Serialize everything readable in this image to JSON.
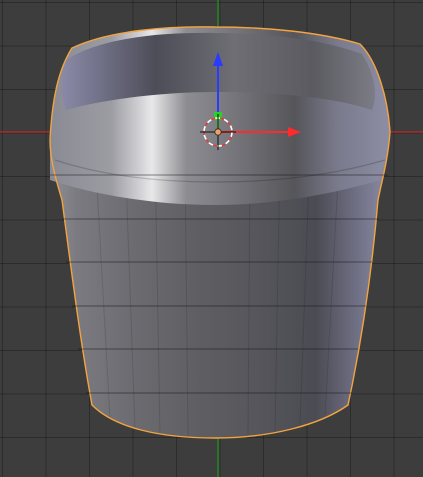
{
  "viewport": {
    "type": "3d-view",
    "grid_color": "#2a2a2a",
    "background_color": "#3d3d3d"
  },
  "axes": {
    "x_axis": {
      "label": "X",
      "color": "#d02626"
    },
    "y_axis": {
      "label": "Y",
      "color": "#18a418"
    }
  },
  "mesh": {
    "name": "cup-mesh",
    "selected": true,
    "outline_color": "#f2a441",
    "face_color_light": "#c8c8d2",
    "face_color_mid": "#6d6d72",
    "face_color_dark": "#4b4b52"
  },
  "manipulator": {
    "x_arrow_color": "#ff2a2a",
    "y_handle_color": "#2ad02a",
    "z_arrow_color": "#2a3aff",
    "pivot_color": "#f0a060"
  },
  "cursor_3d": {
    "ring_colors": [
      "#ffffff",
      "#e33b3b"
    ]
  }
}
